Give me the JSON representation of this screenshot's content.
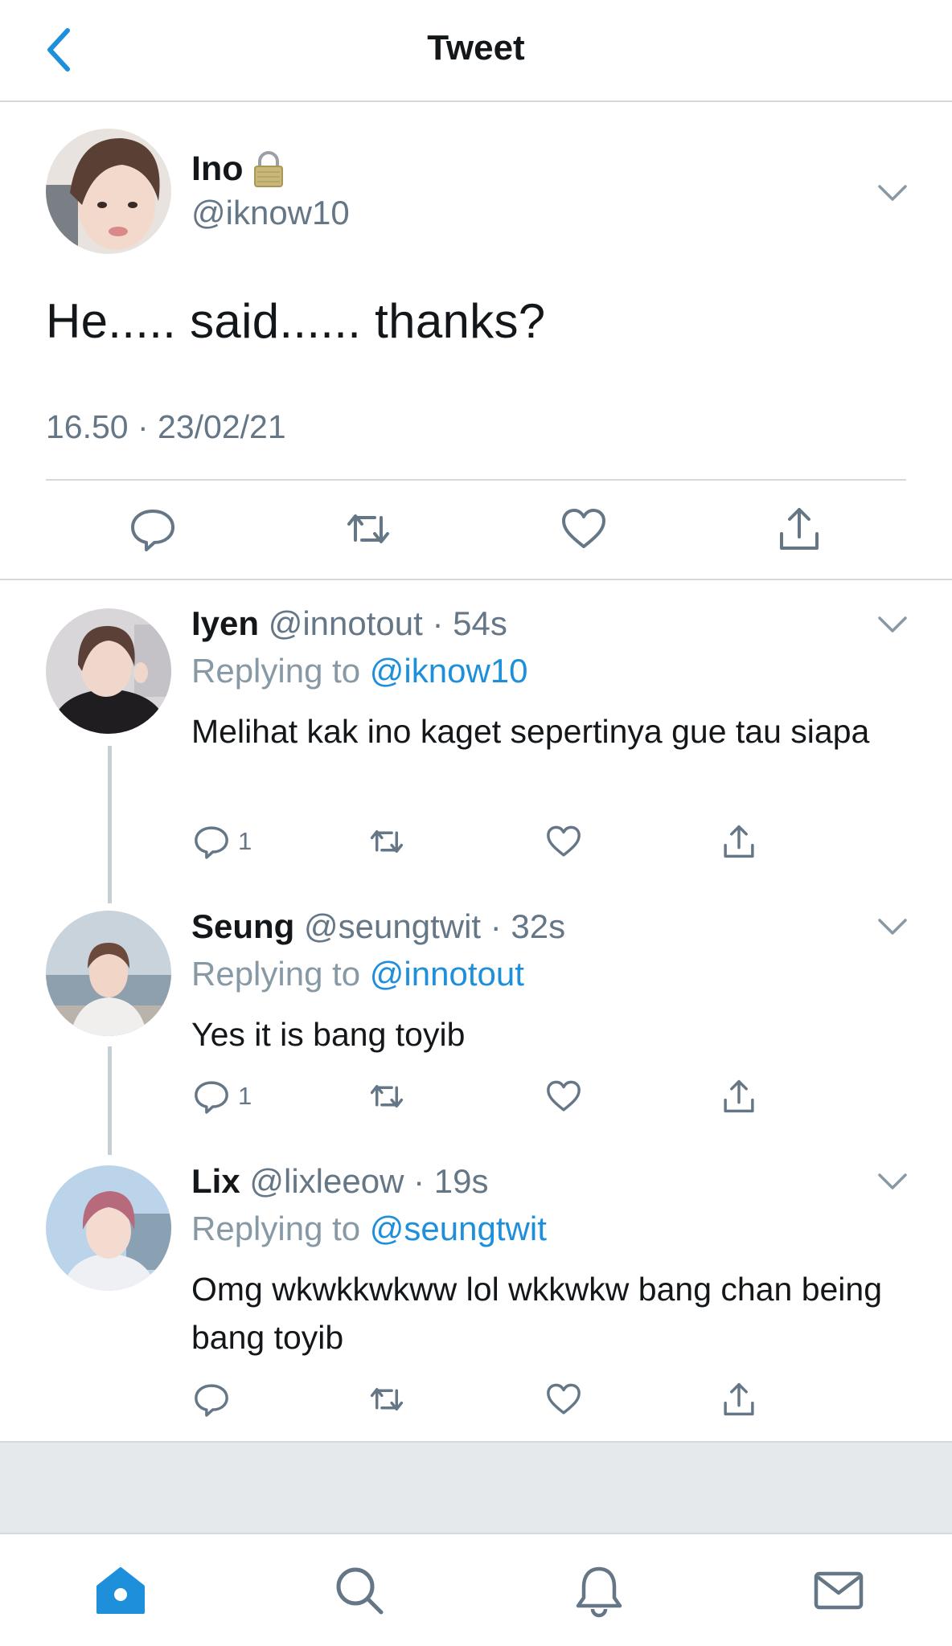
{
  "header": {
    "title": "Tweet"
  },
  "main_tweet": {
    "name": "Ino",
    "handle": "@iknow10",
    "text": "He..... said...... thanks?",
    "timestamp": "16.50 · 23/02/21"
  },
  "replies": [
    {
      "name": "Iyen",
      "handle": "@innotout",
      "time": "· 54s",
      "replying_label": "Replying to ",
      "replying_to": "@iknow10",
      "text": "Melihat kak ino kaget sepertinya gue tau siapa",
      "reply_count": "1"
    },
    {
      "name": "Seung",
      "handle": "@seungtwit",
      "time": "· 32s",
      "replying_label": "Replying to ",
      "replying_to": "@innotout",
      "text": "Yes it is bang toyib",
      "reply_count": "1"
    },
    {
      "name": "Lix",
      "handle": "@lixleeow",
      "time": "· 19s",
      "replying_label": "Replying to ",
      "replying_to": "@seungtwit",
      "text": "Omg wkwkkwkww lol wkkwkw bang chan being bang toyib",
      "reply_count": ""
    }
  ],
  "icons": {
    "back": "chevron-left-icon",
    "lock": "lock-icon",
    "more": "chevron-down-icon",
    "reply": "reply-icon",
    "retweet": "retweet-icon",
    "like": "heart-icon",
    "share": "share-icon",
    "tabs": [
      "home-icon",
      "search-icon",
      "notifications-icon",
      "messages-icon"
    ]
  },
  "colors": {
    "accent": "#1d8fdb",
    "secondary_text": "#657786",
    "divider": "#d5d9dc"
  }
}
